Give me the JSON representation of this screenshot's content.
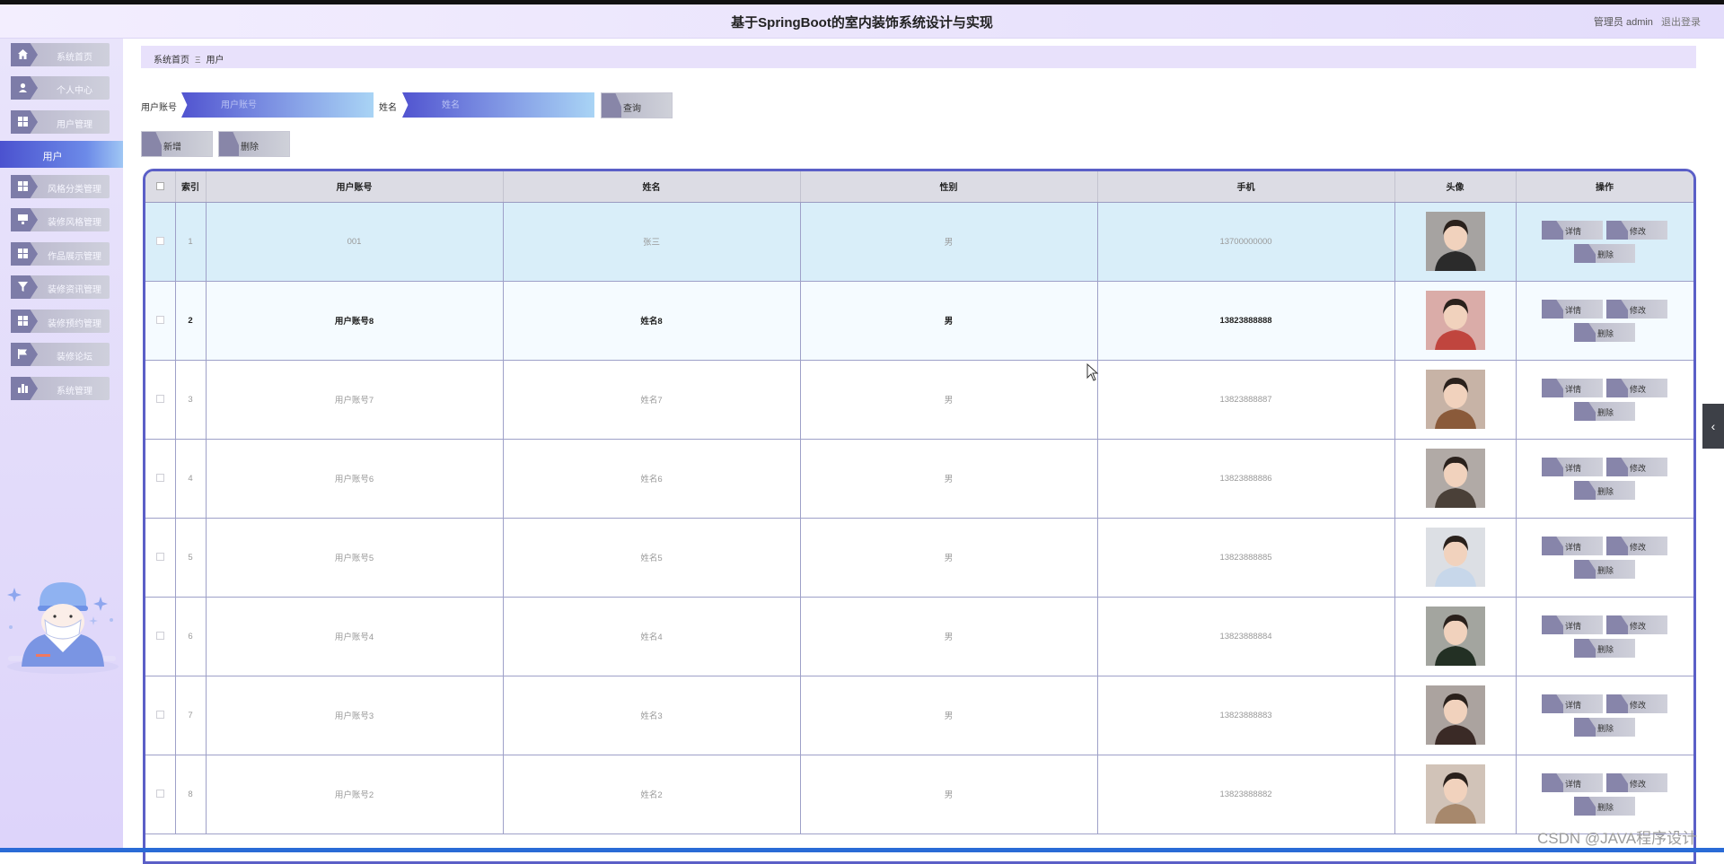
{
  "header": {
    "title": "基于SpringBoot的室内装饰系统设计与实现",
    "user_label": "管理员 admin",
    "logout": "退出登录"
  },
  "sidebar": {
    "items": [
      {
        "label": "系统首页",
        "icon": "home-icon"
      },
      {
        "label": "个人中心",
        "icon": "person-icon"
      },
      {
        "label": "用户管理",
        "icon": "grid-icon"
      },
      {
        "label": "风格分类管理",
        "icon": "grid-icon"
      },
      {
        "label": "装修风格管理",
        "icon": "monitor-icon"
      },
      {
        "label": "作品展示管理",
        "icon": "grid-icon"
      },
      {
        "label": "装修资讯管理",
        "icon": "filter-icon"
      },
      {
        "label": "装修预约管理",
        "icon": "grid-icon"
      },
      {
        "label": "装修论坛",
        "icon": "flag-icon"
      },
      {
        "label": "系统管理",
        "icon": "bar-chart-icon"
      }
    ],
    "active_sub": "用户"
  },
  "breadcrumb": {
    "home": "系统首页",
    "sep": "Ξ",
    "current": "用户"
  },
  "search": {
    "account_label": "用户账号",
    "account_placeholder": "用户账号",
    "name_label": "姓名",
    "name_placeholder": "姓名",
    "query_button": "查询"
  },
  "actions": {
    "add": "新增",
    "delete": "删除"
  },
  "table": {
    "headers": {
      "index": "索引",
      "account": "用户账号",
      "name": "姓名",
      "gender": "性别",
      "phone": "手机",
      "avatar": "头像",
      "ops": "操作"
    },
    "op_labels": {
      "detail": "详情",
      "edit": "修改",
      "delete": "删除"
    },
    "rows": [
      {
        "index": "1",
        "account": "001",
        "name": "张三",
        "gender": "男",
        "phone": "13700000000",
        "avatar_color": "#2b2b2b"
      },
      {
        "index": "2",
        "account": "用户账号8",
        "name": "姓名8",
        "gender": "男",
        "phone": "13823888888",
        "avatar_color": "#c0453e"
      },
      {
        "index": "3",
        "account": "用户账号7",
        "name": "姓名7",
        "gender": "男",
        "phone": "13823888887",
        "avatar_color": "#8a5a3a"
      },
      {
        "index": "4",
        "account": "用户账号6",
        "name": "姓名6",
        "gender": "男",
        "phone": "13823888886",
        "avatar_color": "#4a4038"
      },
      {
        "index": "5",
        "account": "用户账号5",
        "name": "姓名5",
        "gender": "男",
        "phone": "13823888885",
        "avatar_color": "#c7d7ea"
      },
      {
        "index": "6",
        "account": "用户账号4",
        "name": "姓名4",
        "gender": "男",
        "phone": "13823888884",
        "avatar_color": "#233024"
      },
      {
        "index": "7",
        "account": "用户账号3",
        "name": "姓名3",
        "gender": "男",
        "phone": "13823888883",
        "avatar_color": "#3a2a26"
      },
      {
        "index": "8",
        "account": "用户账号2",
        "name": "姓名2",
        "gender": "男",
        "phone": "13823888882",
        "avatar_color": "#a7886c"
      }
    ]
  },
  "watermark": "CSDN @JAVA程序设计"
}
